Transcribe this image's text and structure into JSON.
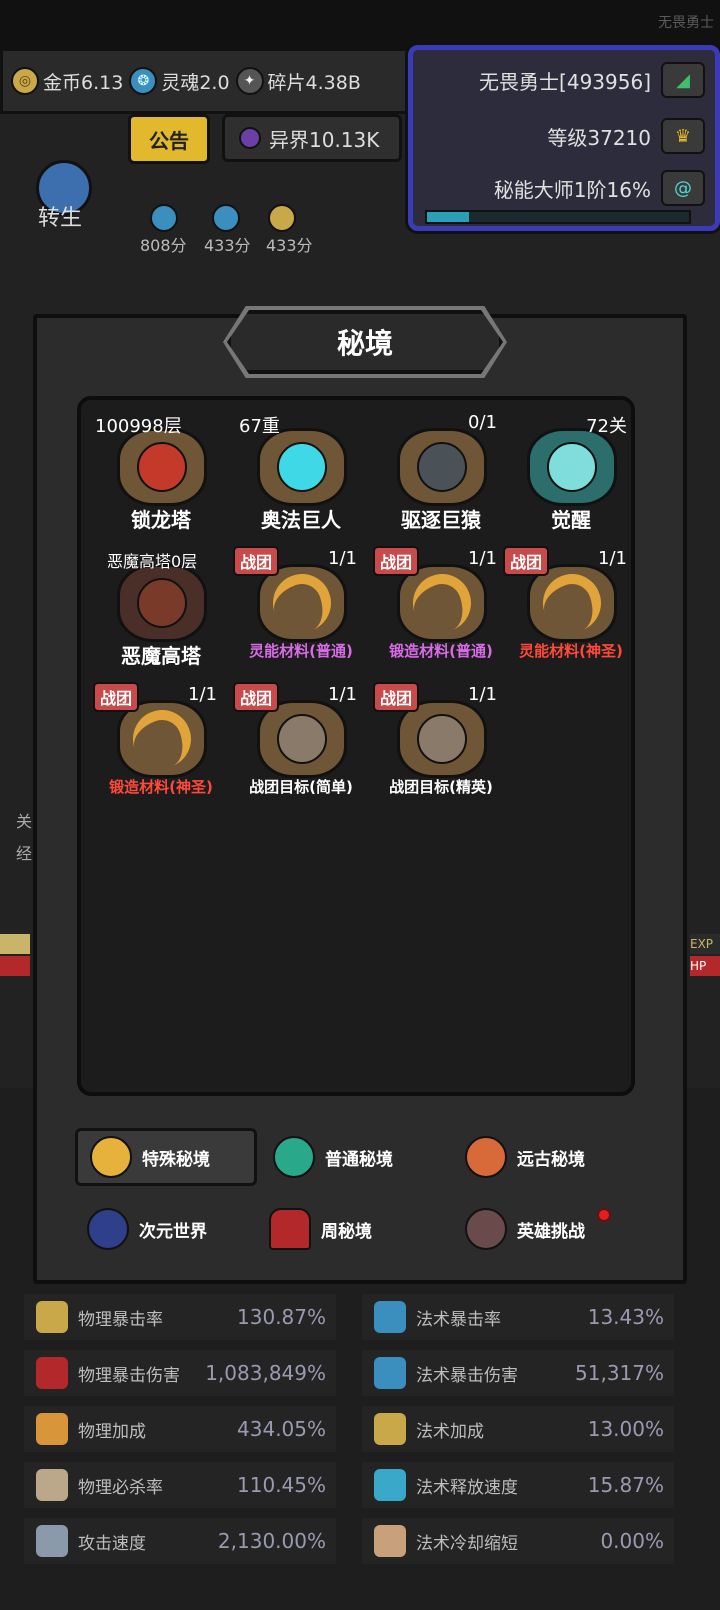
{
  "header": {
    "ghost_name": "无畏勇士"
  },
  "currency": [
    {
      "icon": "gold-coin-icon",
      "label": "金币6.13"
    },
    {
      "icon": "soul-icon",
      "label": "灵魂2.0"
    },
    {
      "icon": "fragment-icon",
      "label": "碎片4.38B"
    }
  ],
  "player": {
    "name": "无畏勇士[493956]",
    "level": "等级37210",
    "mastery": "秘能大师1阶16%",
    "mastery_progress": 0.16
  },
  "top": {
    "notice": "公告",
    "otherworld": "异界10.13K",
    "rebirth": "转生",
    "scores": [
      "808分",
      "433分",
      "433分"
    ]
  },
  "modal": {
    "title": "秘境",
    "cells": [
      {
        "count": "100998层",
        "name": "锁龙塔"
      },
      {
        "count": "67重",
        "name": "奥法巨人"
      },
      {
        "count": "0/1",
        "name": "驱逐巨猿"
      },
      {
        "count": "72关",
        "name": "觉醒"
      },
      {
        "count": "恶魔高塔0层",
        "name": "恶魔高塔"
      },
      {
        "tag": "战团",
        "count": "1/1",
        "name": "灵能材料(普通)"
      },
      {
        "tag": "战团",
        "count": "1/1",
        "name": "锻造材料(普通)"
      },
      {
        "tag": "战团",
        "count": "1/1",
        "name": "灵能材料(神圣)"
      },
      {
        "tag": "战团",
        "count": "1/1",
        "name": "锻造材料(神圣)"
      },
      {
        "tag": "战团",
        "count": "1/1",
        "name": "战团目标(简单)"
      },
      {
        "tag": "战团",
        "count": "1/1",
        "name": "战团目标(精英)"
      }
    ],
    "tabs": [
      "特殊秘境",
      "普通秘境",
      "远古秘境",
      "次元世界",
      "周秘境",
      "英雄挑战"
    ]
  },
  "side": {
    "exp": "EXP",
    "hp": "HP",
    "left1": "关",
    "left2": "经"
  },
  "stats": [
    {
      "label": "物理暴击率",
      "value": "130.87%"
    },
    {
      "label": "法术暴击率",
      "value": "13.43%"
    },
    {
      "label": "物理暴击伤害",
      "value": "1,083,849%"
    },
    {
      "label": "法术暴击伤害",
      "value": "51,317%"
    },
    {
      "label": "物理加成",
      "value": "434.05%"
    },
    {
      "label": "法术加成",
      "value": "13.00%"
    },
    {
      "label": "物理必杀率",
      "value": "110.45%"
    },
    {
      "label": "法术释放速度",
      "value": "15.87%"
    },
    {
      "label": "攻击速度",
      "value": "2,130.00%"
    },
    {
      "label": "法术冷却缩短",
      "value": "0.00%"
    }
  ],
  "colors": {
    "accent_gold": "#e2b82c",
    "player_border": "#3b3bb8",
    "mastery_text": "#4fd8d8",
    "purple_reward": "#d76ce6",
    "red_reward": "#ff4a3a"
  }
}
